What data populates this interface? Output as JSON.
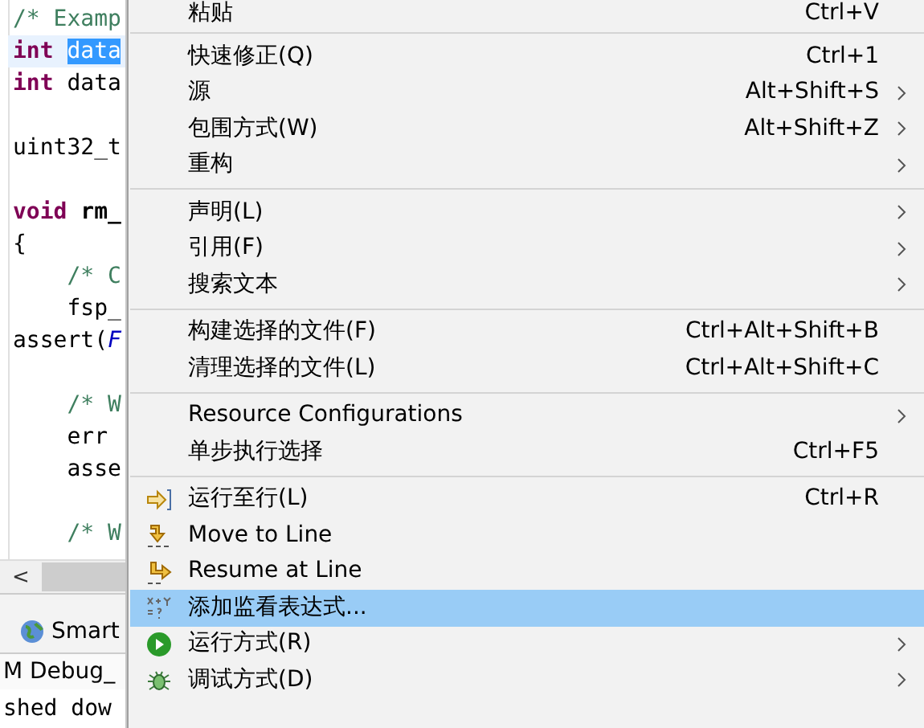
{
  "editor": {
    "lines": [
      {
        "current": false,
        "segments": [
          {
            "text": "/* Examp",
            "kind": "comment"
          }
        ]
      },
      {
        "current": true,
        "segments": [
          {
            "text": "int ",
            "kind": "keyword"
          },
          {
            "text": "data",
            "kind": "selected"
          }
        ]
      },
      {
        "current": false,
        "segments": [
          {
            "text": "int",
            "kind": "keyword"
          },
          {
            "text": " data",
            "kind": "plain"
          }
        ]
      },
      {
        "current": false
      },
      {
        "current": false,
        "segments": [
          {
            "text": "uint32_t",
            "kind": "plain"
          }
        ]
      },
      {
        "current": false
      },
      {
        "current": false,
        "segments": [
          {
            "text": "void",
            "kind": "keyword"
          },
          {
            "text": " rm_",
            "kind": "bold"
          }
        ]
      },
      {
        "current": false,
        "segments": [
          {
            "text": "{",
            "kind": "plain"
          }
        ]
      },
      {
        "current": false,
        "segments": [
          {
            "text": "    /* C",
            "kind": "comment"
          }
        ]
      },
      {
        "current": false,
        "segments": [
          {
            "text": "    fsp_",
            "kind": "plain"
          }
        ]
      },
      {
        "current": false,
        "segments": [
          {
            "text": "assert(",
            "kind": "plain"
          },
          {
            "text": "F",
            "kind": "constant"
          }
        ]
      },
      {
        "current": false
      },
      {
        "current": false,
        "segments": [
          {
            "text": "    /* W",
            "kind": "comment"
          }
        ]
      },
      {
        "current": false,
        "segments": [
          {
            "text": "    err ",
            "kind": "plain"
          }
        ]
      },
      {
        "current": false,
        "segments": [
          {
            "text": "    asse",
            "kind": "plain"
          }
        ]
      },
      {
        "current": false
      },
      {
        "current": false,
        "segments": [
          {
            "text": "    /* W",
            "kind": "comment"
          }
        ]
      }
    ],
    "scroll_left": "<"
  },
  "tabs": [
    {
      "label": "Smart",
      "selected": false
    }
  ],
  "console": {
    "title": "M Debug_",
    "text": "shed dow"
  },
  "menu": {
    "items": [
      {
        "kind": "item",
        "label": "粘贴",
        "shortcut": "Ctrl+V",
        "submenu": false,
        "selected": false
      },
      {
        "kind": "separator"
      },
      {
        "kind": "item",
        "label": "快速修正(Q)",
        "shortcut": "Ctrl+1",
        "submenu": false,
        "selected": false
      },
      {
        "kind": "item",
        "label": "源",
        "shortcut": "Alt+Shift+S",
        "submenu": true,
        "selected": false
      },
      {
        "kind": "item",
        "label": "包围方式(W)",
        "shortcut": "Alt+Shift+Z",
        "submenu": true,
        "selected": false
      },
      {
        "kind": "item",
        "label": "重构",
        "submenu": true,
        "selected": false
      },
      {
        "kind": "separator"
      },
      {
        "kind": "item",
        "label": "声明(L)",
        "submenu": true,
        "selected": false
      },
      {
        "kind": "item",
        "label": "引用(F)",
        "submenu": true,
        "selected": false
      },
      {
        "kind": "item",
        "label": "搜索文本",
        "submenu": true,
        "selected": false
      },
      {
        "kind": "separator"
      },
      {
        "kind": "item",
        "label": "构建选择的文件(F)",
        "shortcut": "Ctrl+Alt+Shift+B",
        "submenu": false,
        "selected": false
      },
      {
        "kind": "item",
        "label": "清理选择的文件(L)",
        "shortcut": "Ctrl+Alt+Shift+C",
        "submenu": false,
        "selected": false
      },
      {
        "kind": "separator"
      },
      {
        "kind": "item",
        "label": "Resource Configurations",
        "submenu": true,
        "selected": false
      },
      {
        "kind": "item",
        "label": "单步执行选择",
        "shortcut": "Ctrl+F5",
        "submenu": false,
        "selected": false
      },
      {
        "kind": "separator"
      },
      {
        "kind": "item",
        "label": "运行至行(L)",
        "shortcut": "Ctrl+R",
        "submenu": false,
        "selected": false
      },
      {
        "kind": "item",
        "label": "Move to Line",
        "submenu": false,
        "selected": false
      },
      {
        "kind": "item",
        "label": "Resume at Line",
        "submenu": false,
        "selected": false
      },
      {
        "kind": "item",
        "label": "添加监看表达式...",
        "submenu": false,
        "selected": true
      },
      {
        "kind": "item",
        "label": "运行方式(R)",
        "submenu": true,
        "selected": false
      },
      {
        "kind": "item",
        "label": "调试方式(D)",
        "submenu": true,
        "selected": false
      }
    ]
  }
}
